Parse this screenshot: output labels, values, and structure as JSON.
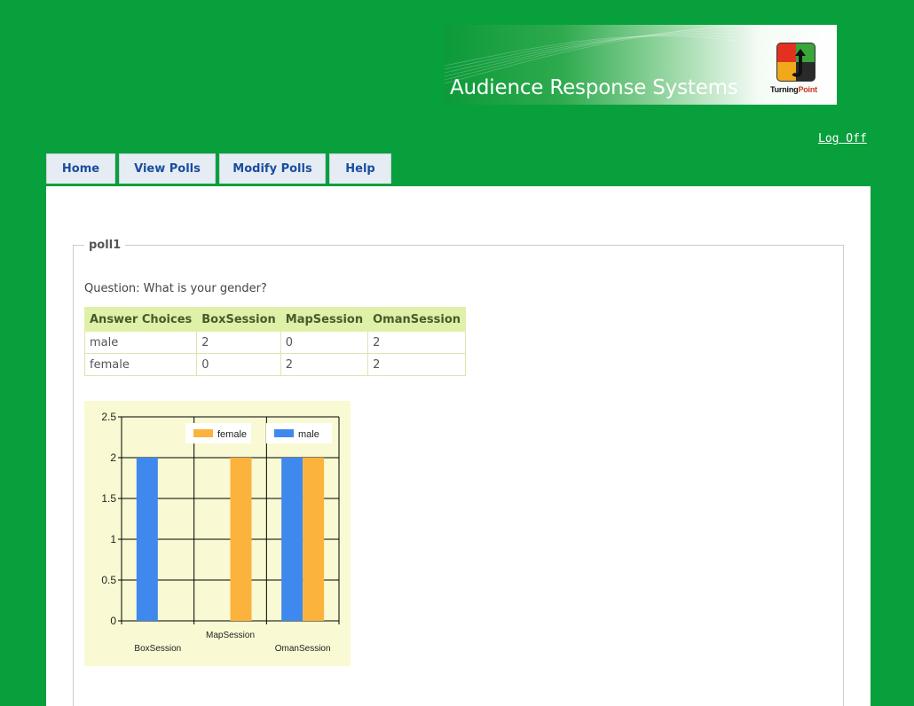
{
  "banner": {
    "title": "Audience Response Systems",
    "logo_text_turning": "Turning",
    "logo_text_point": "Point"
  },
  "header": {
    "logoff_label": "Log Off"
  },
  "nav": {
    "tabs": [
      {
        "label": "Home"
      },
      {
        "label": "View Polls"
      },
      {
        "label": "Modify Polls"
      },
      {
        "label": "Help"
      }
    ]
  },
  "poll": {
    "name": "poll1",
    "question": "Question: What is your gender?",
    "table": {
      "headers": [
        "Answer Choices",
        "BoxSession",
        "MapSession",
        "OmanSession"
      ],
      "rows": [
        [
          "male",
          "2",
          "0",
          "2"
        ],
        [
          "female",
          "0",
          "2",
          "2"
        ]
      ]
    }
  },
  "colors": {
    "page_bg": "#08a03c",
    "male": "#3e88ee",
    "female": "#fbb33e",
    "chart_bg": "#f9f9d3"
  },
  "chart_data": {
    "type": "bar",
    "categories": [
      "BoxSession",
      "MapSession",
      "OmanSession"
    ],
    "series": [
      {
        "name": "male",
        "values": [
          2,
          0,
          2
        ]
      },
      {
        "name": "female",
        "values": [
          0,
          2,
          2
        ]
      }
    ],
    "ylim": [
      0,
      2.5
    ],
    "yticks": [
      "0",
      "0.5",
      "1",
      "1.5",
      "2",
      "2.5"
    ],
    "grid": true,
    "legend": [
      "female",
      "male"
    ],
    "legend_position": "top"
  }
}
